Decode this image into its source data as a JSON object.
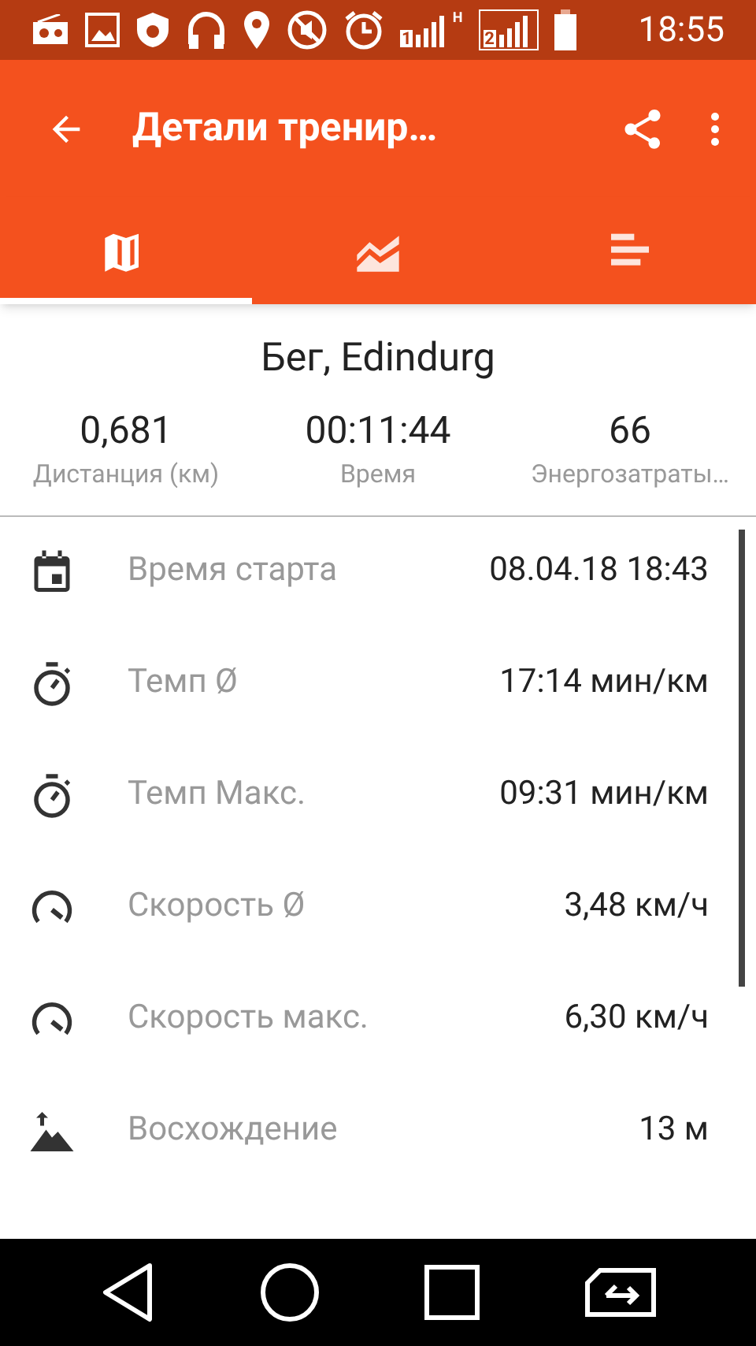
{
  "status_bar": {
    "time": "18:55",
    "sim1_label": "1",
    "sim2_label": "2",
    "network_label": "H"
  },
  "app_bar": {
    "title": "Детали тренир…"
  },
  "tabs": [
    {
      "kind": "map",
      "selected": true
    },
    {
      "kind": "chart",
      "selected": false
    },
    {
      "kind": "bars",
      "selected": false
    }
  ],
  "summary": {
    "title": "Бег, Edindurg",
    "stats": [
      {
        "value": "0,681",
        "label": "Дистанция (км)"
      },
      {
        "value": "00:11:44",
        "label": "Время"
      },
      {
        "value": "66",
        "label": "Энергозатраты…"
      }
    ]
  },
  "details": [
    {
      "kind": "calendar",
      "label": "Время старта",
      "value": "08.04.18 18:43"
    },
    {
      "kind": "stopwatch",
      "label": "Темп Ø",
      "value": "17:14 мин/км"
    },
    {
      "kind": "stopwatch",
      "label": "Темп Макс.",
      "value": "09:31 мин/км"
    },
    {
      "kind": "speedometer",
      "label": "Скорость Ø",
      "value": "3,48 км/ч"
    },
    {
      "kind": "speedometer",
      "label": "Скорость макс.",
      "value": "6,30 км/ч"
    },
    {
      "kind": "ascent",
      "label": "Восхождение",
      "value": "13 м"
    }
  ]
}
